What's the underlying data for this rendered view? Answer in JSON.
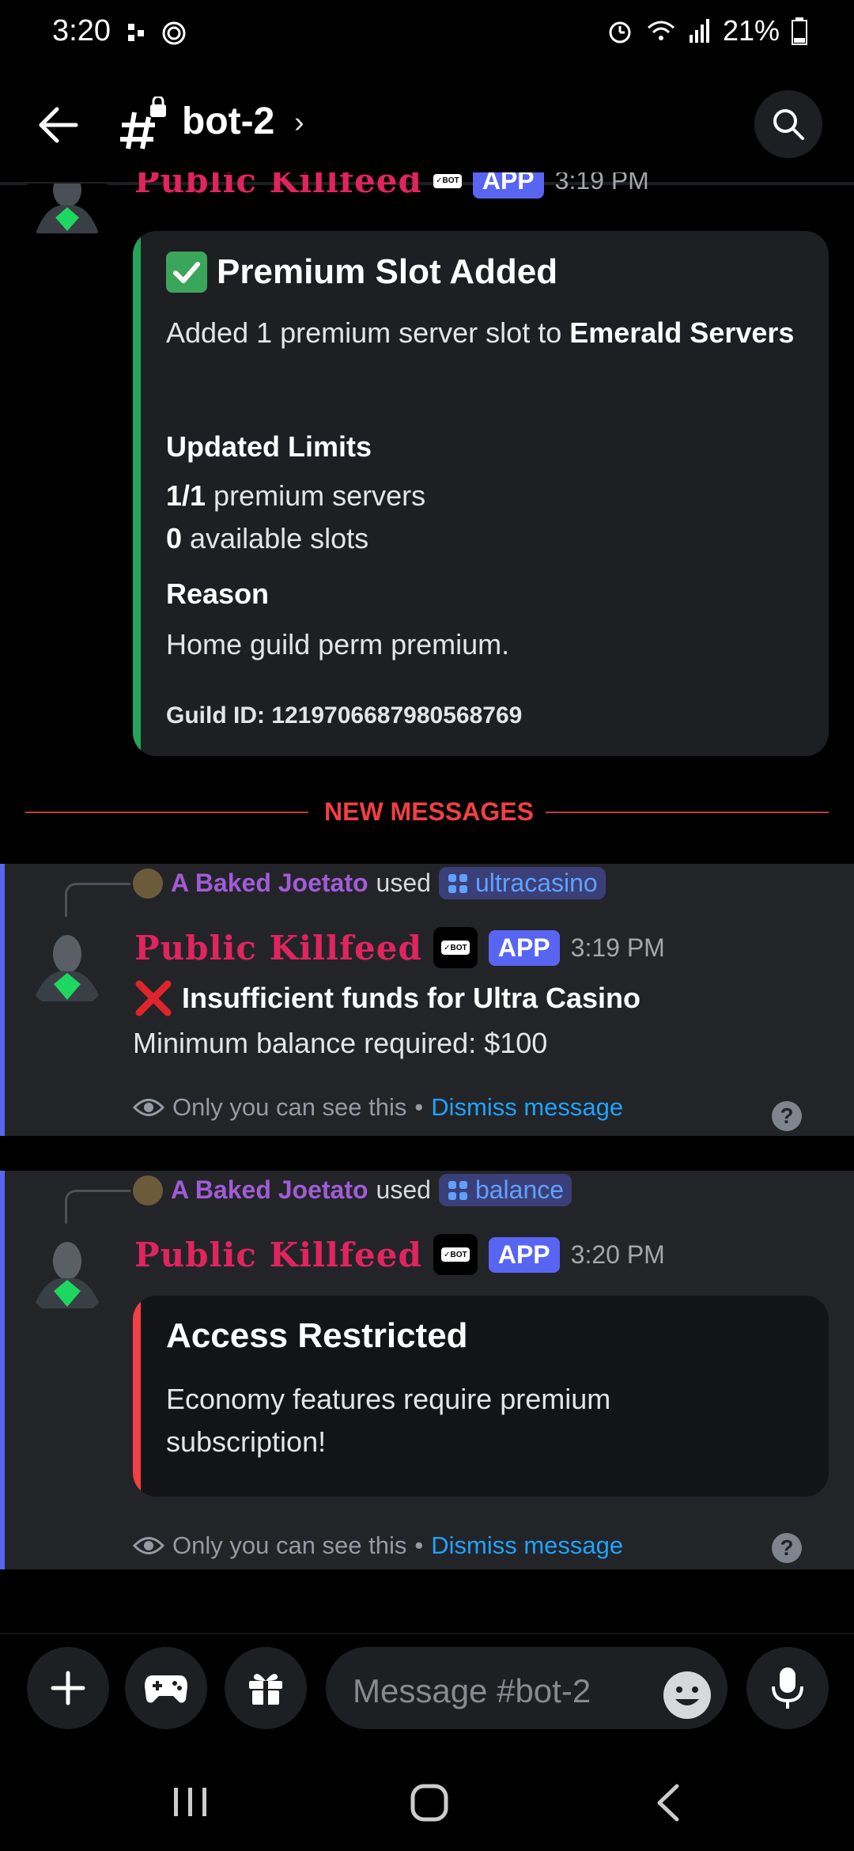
{
  "status_bar": {
    "time": "3:20",
    "battery": "21%"
  },
  "header": {
    "channel": "bot-2"
  },
  "msg1": {
    "bot_name": "Public Killfeed",
    "app_badge": "APP",
    "time": "3:19 PM",
    "embed": {
      "title": "Premium Slot Added",
      "desc_prefix": "Added 1 premium server slot to ",
      "desc_bold": "Emerald Servers",
      "section1_title": "Updated Limits",
      "line1_bold": "1/1",
      "line1_rest": " premium servers",
      "line2_bold": "0",
      "line2_rest": " available slots",
      "section2_title": "Reason",
      "reason": "Home guild perm premium.",
      "footer": "Guild ID: 1219706687980568769",
      "accent": "#23a55a"
    }
  },
  "new_messages": "NEW MESSAGES",
  "msg2": {
    "user": "A Baked Joetato",
    "used": "used",
    "command": "ultracasino",
    "bot_name": "Public Killfeed",
    "app_badge": "APP",
    "time": "3:19 PM",
    "line1": "Insufficient funds for Ultra Casino",
    "line2": "Minimum balance required: $100",
    "ephemeral": "Only you can see this",
    "dot": "•",
    "dismiss": "Dismiss message"
  },
  "msg3": {
    "user": "A Baked Joetato",
    "used": "used",
    "command": "balance",
    "bot_name": "Public Killfeed",
    "app_badge": "APP",
    "time": "3:20 PM",
    "embed": {
      "title": "Access Restricted",
      "desc": "Economy features require premium subscription!",
      "accent": "#f23f43"
    },
    "ephemeral": "Only you can see this",
    "dot": "•",
    "dismiss": "Dismiss message"
  },
  "composer": {
    "placeholder": "Message #bot-2"
  },
  "icons": [
    "back-arrow-icon",
    "hash-lock-icon",
    "search-icon",
    "plus-icon",
    "gamepad-icon",
    "gift-icon",
    "emoji-icon",
    "microphone-icon",
    "eye-icon",
    "help-icon"
  ]
}
